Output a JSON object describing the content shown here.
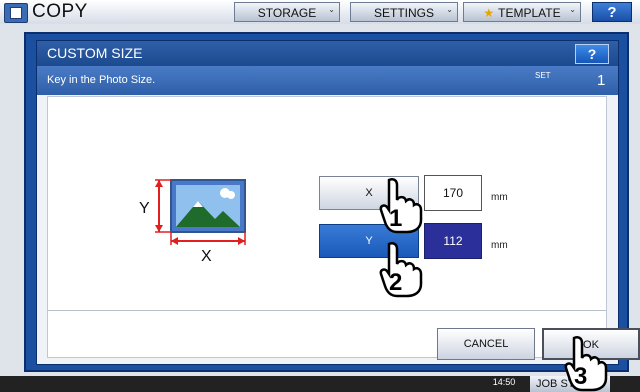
{
  "topbar": {
    "title": "COPY",
    "storage_label": "STORAGE",
    "settings_label": "SETTINGS",
    "template_label": "TEMPLATE",
    "help_label": "?"
  },
  "dialog": {
    "title": "CUSTOM SIZE",
    "help_label": "?",
    "instruction": "Key in the Photo Size.",
    "set_label": "SET",
    "set_count": "1"
  },
  "diagram": {
    "y_label": "Y",
    "x_label": "X"
  },
  "fields": {
    "x": {
      "label": "X",
      "value": "170",
      "unit": "mm"
    },
    "y": {
      "label": "Y",
      "value": "112",
      "unit": "mm"
    }
  },
  "buttons": {
    "cancel": "CANCEL",
    "ok": "OK"
  },
  "callouts": {
    "one": "1",
    "two": "2",
    "three": "3"
  },
  "status": {
    "time": "14:50",
    "job_status": "JOB STATUS"
  },
  "colors": {
    "accent": "#1b4fa0",
    "selected": "#1959b8",
    "value_selected": "#2b2f9a"
  }
}
